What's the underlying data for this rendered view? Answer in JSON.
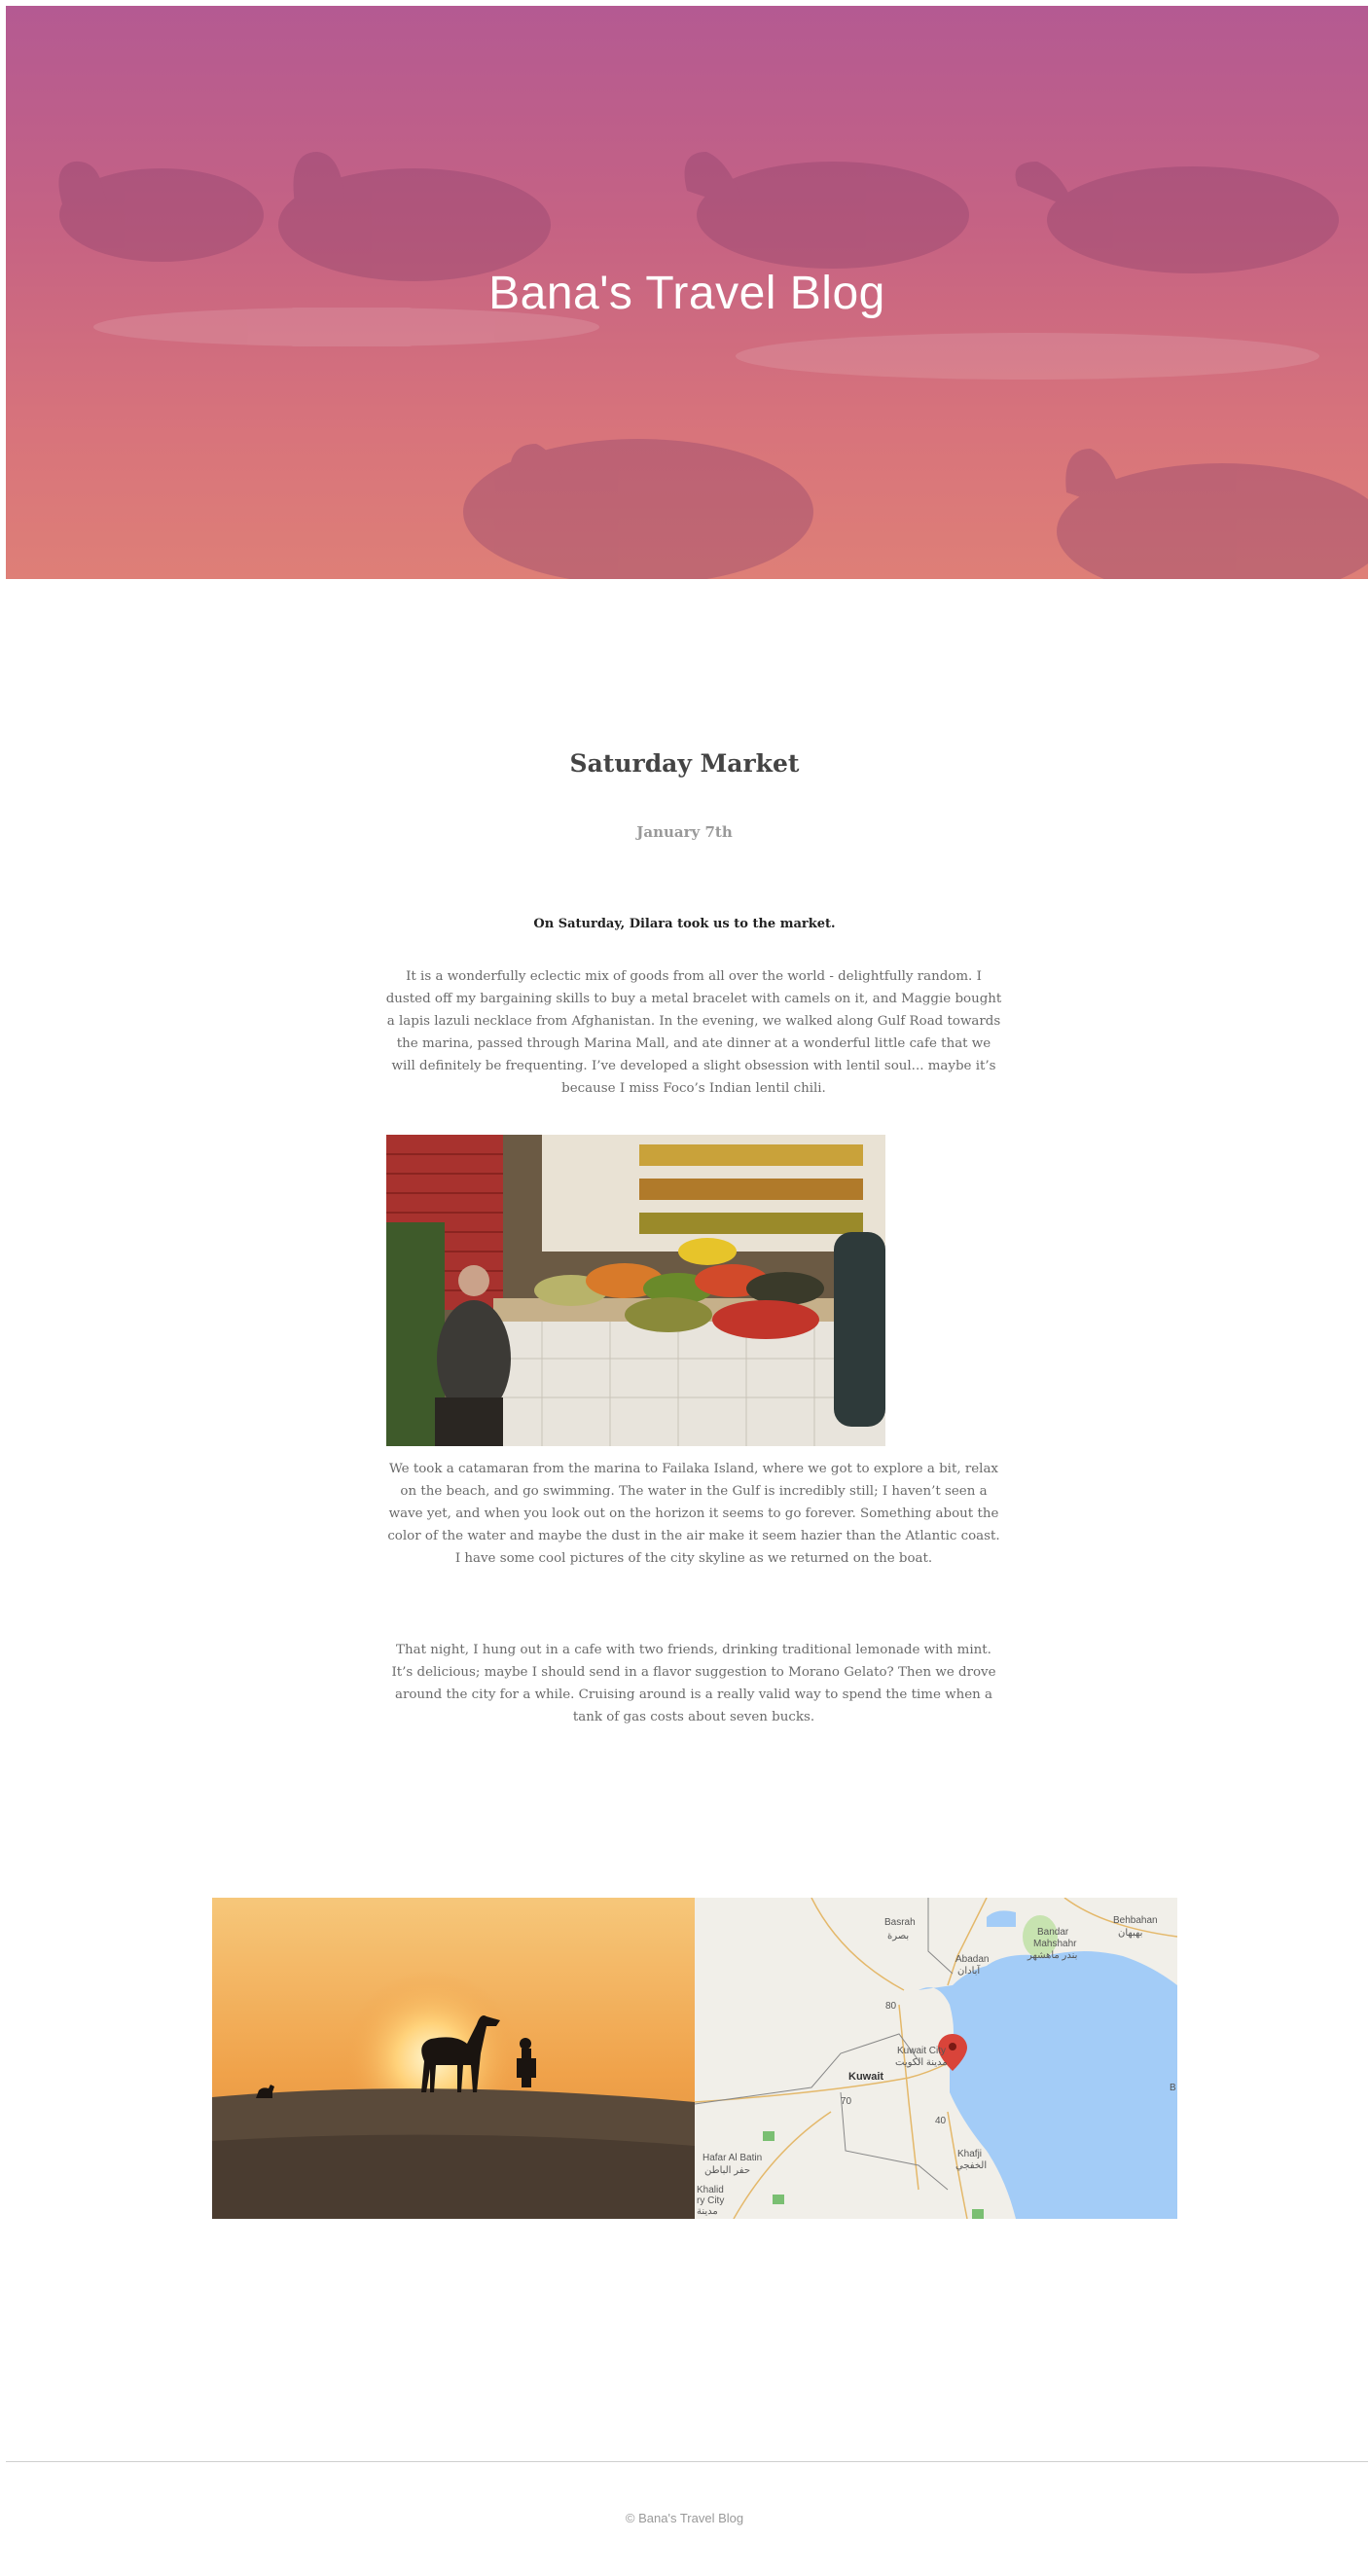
{
  "hero": {
    "title": "Bana's Travel Blog"
  },
  "post": {
    "title": "Saturday Market",
    "date": "January 7th",
    "lead": "On Saturday, Dilara took us to the market.",
    "paragraph1": "It is a wonderfully eclectic mix of goods from all over the world - delightfully random. I dusted off my bargaining skills to buy a metal bracelet with camels on it, and Maggie bought a lapis lazuli necklace from Afghanistan. In the evening, we walked along Gulf Road towards the marina, passed through Marina Mall, and ate dinner at a wonderful little cafe that we will definitely be frequenting. I’ve developed a slight obsession with lentil soul... maybe it’s because I miss Foco’s Indian lentil chili.",
    "paragraph2": "We took a catamaran from the marina to Failaka Island, where we got to explore a bit, relax on the beach, and go swimming. The water in the Gulf is incredibly still; I haven’t seen a wave yet, and when you look out on the horizon it seems to go forever. Something about the color of the water and maybe the dust in the air make it seem hazier than the Atlantic coast. I have some cool pictures of the city skyline as we returned on the boat.",
    "paragraph3": "That night, I hung out in a cafe with two friends, drinking traditional lemonade with mint. It’s delicious; maybe I should send in a flavor suggestion to Morano Gelato? Then we drove around the city for a while. Cruising around is a really valid way to spend the time when a tank of gas costs about seven bucks."
  },
  "map": {
    "labels": {
      "basrah": "Basrah",
      "basrah_ar": "بصرة",
      "abadan": "Abadan",
      "abadan_ar": "آبادان",
      "bandar": "Bandar",
      "mahshahr": "Mahshahr",
      "mahshahr_ar": "بندر ماهشهر",
      "behbahan": "Behbahan",
      "behbahan_ar": "بهبهان",
      "kuwait": "Kuwait",
      "kuwait_city": "Kuwait City",
      "kuwait_city_ar": "مدينة الكويت",
      "hafar": "Hafar Al Batin",
      "hafar_ar": "حفر الباطن",
      "khafji": "Khafji",
      "khafji_ar": "الخفجي",
      "khalid": "Khalid",
      "khalid2": "ry City",
      "khalid_ar": "مدينة",
      "road80": "80",
      "road70": "70",
      "road40": "40",
      "edge_b": "B"
    },
    "colors": {
      "water": "#a3ccf7",
      "land": "#f1efe9",
      "marker": "#d9443a"
    }
  },
  "footer": {
    "text": "© Bana's Travel Blog"
  }
}
